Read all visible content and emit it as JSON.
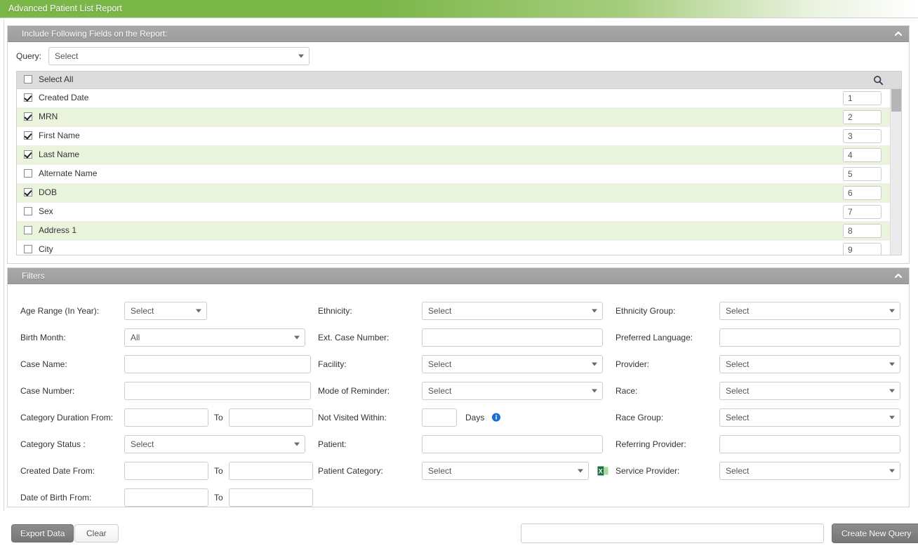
{
  "header": {
    "title": "Advanced Patient List Report",
    "brand_color": "#7ab648"
  },
  "fields_panel": {
    "title": "Include Following Fields on the Report:",
    "collapse_icon": "chevron-up-icon",
    "query_label": "Query:",
    "query_value": "Select",
    "select_all_label": "Select All",
    "search_icon": "search-icon",
    "rows": [
      {
        "label": "Created Date",
        "checked": true,
        "order": "1"
      },
      {
        "label": "MRN",
        "checked": true,
        "order": "2"
      },
      {
        "label": "First Name",
        "checked": true,
        "order": "3"
      },
      {
        "label": "Last Name",
        "checked": true,
        "order": "4"
      },
      {
        "label": "Alternate Name",
        "checked": false,
        "order": "5"
      },
      {
        "label": "DOB",
        "checked": true,
        "order": "6"
      },
      {
        "label": "Sex",
        "checked": false,
        "order": "7"
      },
      {
        "label": "Address 1",
        "checked": false,
        "order": "8"
      },
      {
        "label": "City",
        "checked": false,
        "order": "9"
      }
    ]
  },
  "filters_panel": {
    "title": "Filters",
    "collapse_icon": "chevron-up-icon",
    "to_label": "To",
    "days_label": "Days",
    "info_icon": "info-icon",
    "excel_icon": "excel-export-icon",
    "column1": [
      {
        "label": "Age Range (In Year):",
        "type": "select",
        "value": "Select"
      },
      {
        "label": "Birth Month:",
        "type": "select",
        "value": "All"
      },
      {
        "label": "Case Name:",
        "type": "text",
        "value": ""
      },
      {
        "label": "Case Number:",
        "type": "text",
        "value": ""
      },
      {
        "label": "Category Duration From:",
        "type": "range",
        "value": "",
        "value2": ""
      },
      {
        "label": "Category Status :",
        "type": "select",
        "value": "Select"
      },
      {
        "label": "Created Date From:",
        "type": "range",
        "value": "",
        "value2": ""
      },
      {
        "label": "Date of Birth From:",
        "type": "range",
        "value": "",
        "value2": ""
      }
    ],
    "column2": [
      {
        "label": "Ethnicity:",
        "type": "select",
        "value": "Select"
      },
      {
        "label": "Ext. Case Number:",
        "type": "text",
        "value": ""
      },
      {
        "label": "Facility:",
        "type": "select",
        "value": "Select"
      },
      {
        "label": "Mode of Reminder:",
        "type": "select",
        "value": "Select"
      },
      {
        "label": "Not Visited Within:",
        "type": "days",
        "value": ""
      },
      {
        "label": "Patient:",
        "type": "text",
        "value": ""
      },
      {
        "label": "Patient Category:",
        "type": "select-excel",
        "value": "Select"
      }
    ],
    "column3": [
      {
        "label": "Ethnicity Group:",
        "type": "select",
        "value": "Select"
      },
      {
        "label": "Preferred Language:",
        "type": "text",
        "value": ""
      },
      {
        "label": "Provider:",
        "type": "select",
        "value": "Select"
      },
      {
        "label": "Race:",
        "type": "select",
        "value": "Select"
      },
      {
        "label": "Race Group:",
        "type": "select",
        "value": "Select"
      },
      {
        "label": "Referring Provider:",
        "type": "text",
        "value": ""
      },
      {
        "label": "Service Provider:",
        "type": "select",
        "value": "Select"
      }
    ]
  },
  "footer": {
    "export_label": "Export Data",
    "clear_label": "Clear",
    "query_name_value": "",
    "create_query_label": "Create New Query"
  }
}
